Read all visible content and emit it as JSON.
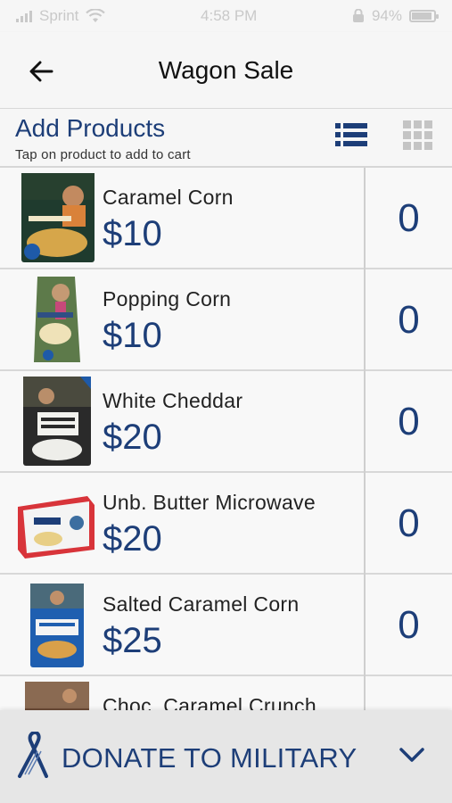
{
  "status_bar": {
    "carrier": "Sprint",
    "time": "4:58 PM",
    "battery": "94%"
  },
  "app_bar": {
    "title": "Wagon Sale"
  },
  "products_header": {
    "title": "Add Products",
    "subtitle": "Tap on product to add to cart"
  },
  "products": [
    {
      "name": "Caramel Corn",
      "price": "$10",
      "qty": "0"
    },
    {
      "name": "Popping Corn",
      "price": "$10",
      "qty": "0"
    },
    {
      "name": "White Cheddar",
      "price": "$20",
      "qty": "0"
    },
    {
      "name": "Unb. Butter Microwave",
      "price": "$20",
      "qty": "0"
    },
    {
      "name": "Salted Caramel Corn",
      "price": "$25",
      "qty": "0"
    },
    {
      "name": "Choc. Caramel Crunch",
      "price": "",
      "qty": ""
    }
  ],
  "donate": {
    "label": "DONATE TO MILITARY"
  },
  "colors": {
    "accent": "#1d3e78",
    "background": "#f6f6f6"
  }
}
